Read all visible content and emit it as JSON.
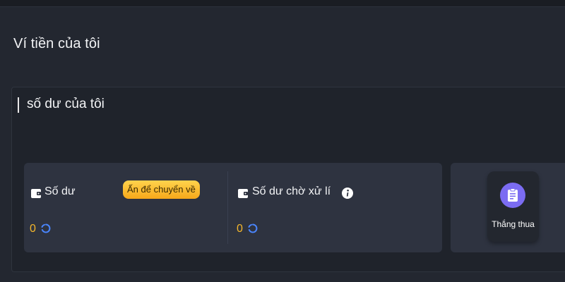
{
  "page": {
    "title": "Ví tiền của tôi"
  },
  "section": {
    "title": "số dư của tôi"
  },
  "balance": {
    "label": "Số dư",
    "transfer_button": "Ấn để chuyển về",
    "amount": "0"
  },
  "pending": {
    "label": "Số dư chờ xử lí",
    "amount": "0"
  },
  "shortcut": {
    "label": "Thắng thua"
  },
  "colors": {
    "accent_amount": "#f5b72b",
    "badge": "#ffc53d",
    "refresh": "#4a86ff",
    "tile_icon": "#7b6cf2"
  },
  "icons": [
    "wallet-icon",
    "refresh-icon",
    "info-icon",
    "clipboard-icon"
  ]
}
